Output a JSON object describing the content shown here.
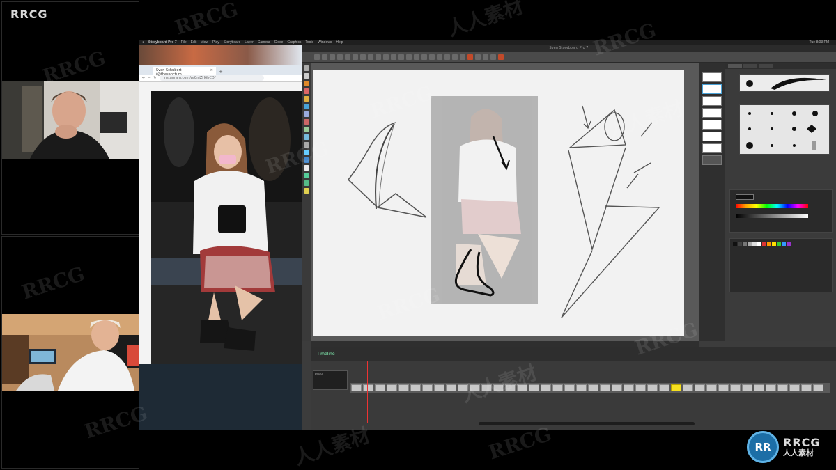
{
  "call": {
    "brand": "RRCG"
  },
  "mac": {
    "app_name": "Storyboard Pro 7",
    "menu": [
      "File",
      "Edit",
      "View",
      "Play",
      "Storyboard",
      "Layer",
      "Camera",
      "Close",
      "Graphics",
      "Tools",
      "Windows",
      "Help"
    ],
    "clock": "Tue 8:03 PM"
  },
  "browser": {
    "tab_title": "Sven Schubert (@thesanctum...",
    "url": "instagram.com/p/CnjZH6hCD/"
  },
  "storyboard": {
    "window_title": "Sven Storyboard Pro 7",
    "timeline_label": "Timeline",
    "track_label": "Panel"
  },
  "watermark": {
    "latin": "RRCG",
    "cjk": "人人素材"
  },
  "logo": {
    "mark": "RR",
    "name": "RRCG",
    "sub": "人人素材"
  },
  "colors": {
    "selected_frame": "#f5e020",
    "canvas": "#f2f2f2",
    "ui_dark": "#3c3c3c"
  }
}
